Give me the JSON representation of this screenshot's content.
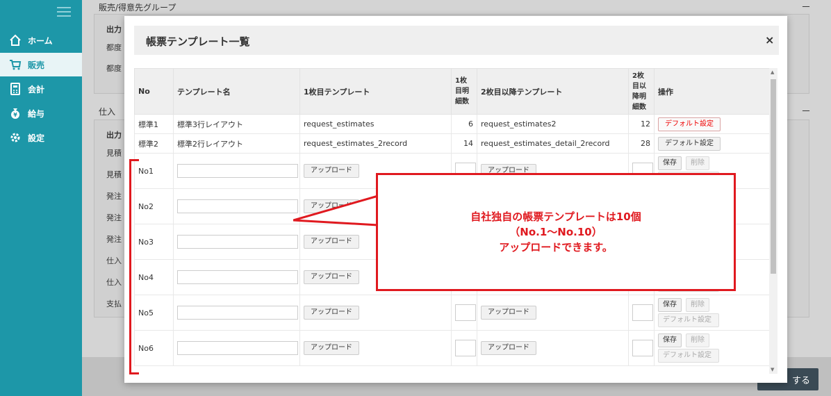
{
  "sidebar": {
    "items": [
      {
        "label": "ホーム",
        "icon": "home-icon"
      },
      {
        "label": "販売",
        "icon": "cart-icon"
      },
      {
        "label": "会計",
        "icon": "calculator-icon"
      },
      {
        "label": "給与",
        "icon": "money-bag-icon"
      },
      {
        "label": "設定",
        "icon": "gear-icon"
      }
    ],
    "active": "販売"
  },
  "background": {
    "panel1_title": "販売/得意先グループ",
    "panel1_col": "出力",
    "panel1_rows": [
      "都度",
      "都度"
    ],
    "panel2_title": "仕入",
    "panel2_col": "出力",
    "panel2_rows": [
      "見積",
      "見積",
      "発注",
      "発注",
      "発注",
      "仕入",
      "仕入",
      "支払"
    ],
    "footer_button": "する",
    "collapse": "－"
  },
  "modal": {
    "title": "帳票テンプレート一覧",
    "close": "×",
    "headers": {
      "no": "No",
      "name": "テンプレート名",
      "first": "1枚目テンプレート",
      "first_rows": "1枚目明細数",
      "second": "2枚目以降テンプレート",
      "second_rows": "2枚目以降明細数",
      "ops": "操作"
    },
    "fixed_rows": [
      {
        "no": "標準1",
        "name": "標準3行レイアウト",
        "first": "request_estimates",
        "first_count": "6",
        "second": "request_estimates2",
        "second_count": "12",
        "op": "デフォルト設定"
      },
      {
        "no": "標準2",
        "name": "標準2行レイアウト",
        "first": "request_estimates_2record",
        "first_count": "14",
        "second": "request_estimates_detail_2record",
        "second_count": "28",
        "op": "デフォルト設定"
      }
    ],
    "custom_rows": [
      {
        "no": "No1"
      },
      {
        "no": "No2"
      },
      {
        "no": "No3"
      },
      {
        "no": "No4"
      },
      {
        "no": "No5"
      },
      {
        "no": "No6"
      }
    ],
    "upload_label": "アップロード",
    "save_label": "保存",
    "delete_label": "削除",
    "default_label": "デフォルト設定"
  },
  "callout": {
    "line1": "自社独自の帳票テンプレートは10個",
    "line2": "（No.1～No.10）",
    "line3": "アップロードできます。"
  },
  "colors": {
    "sidebar": "#1d97a8",
    "annotation": "#e0191f"
  }
}
